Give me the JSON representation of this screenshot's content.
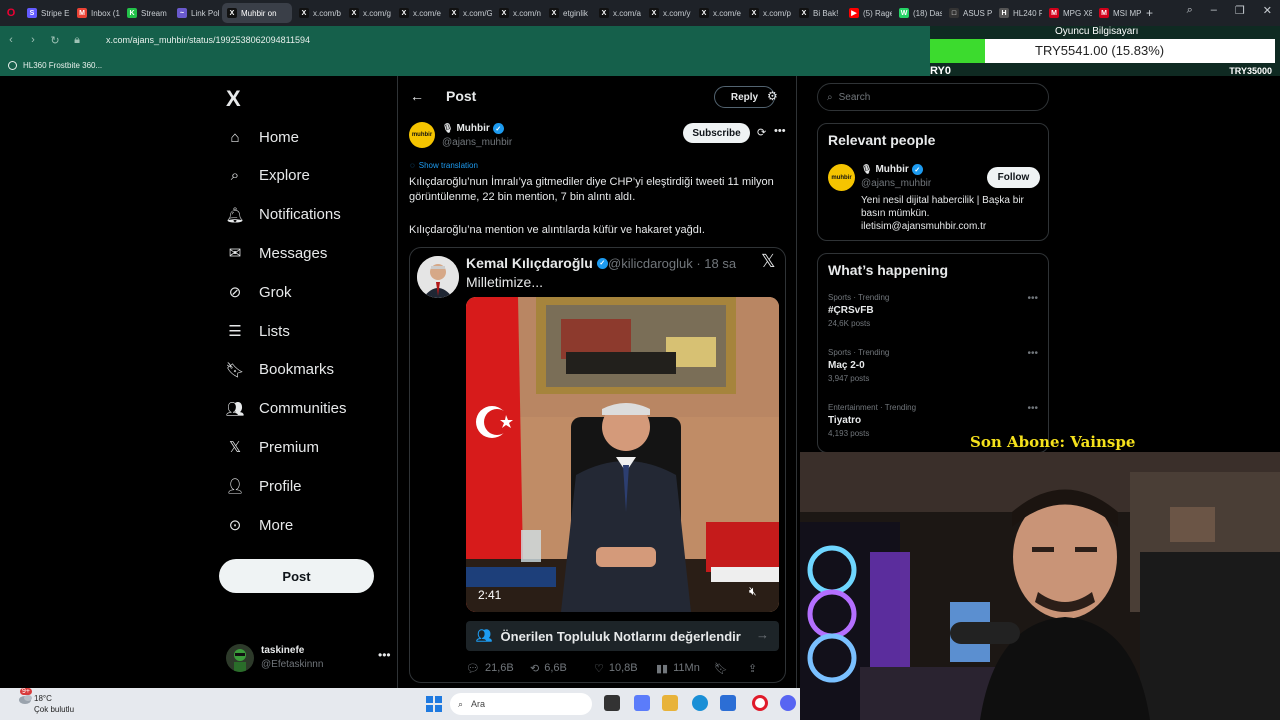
{
  "browser": {
    "tabs": [
      {
        "label": "Stripe E",
        "color": "#635bff",
        "icon": "S"
      },
      {
        "label": "Inbox (1",
        "color": "#ea4335",
        "icon": "M"
      },
      {
        "label": "Stream",
        "color": "#23c24a",
        "icon": "K"
      },
      {
        "label": "Link Pol",
        "color": "#6a5acd",
        "icon": "~"
      },
      {
        "label": "Muhbir on",
        "color": "#111111",
        "icon": "X",
        "active": true
      },
      {
        "label": "x.com/b",
        "color": "#111111",
        "icon": "X"
      },
      {
        "label": "x.com/g",
        "color": "#111111",
        "icon": "X"
      },
      {
        "label": "x.com/e",
        "color": "#111111",
        "icon": "X"
      },
      {
        "label": "x.com/G",
        "color": "#111111",
        "icon": "X"
      },
      {
        "label": "x.com/n",
        "color": "#111111",
        "icon": "X"
      },
      {
        "label": "etginlik",
        "color": "#111111",
        "icon": "X"
      },
      {
        "label": "x.com/a",
        "color": "#111111",
        "icon": "X"
      },
      {
        "label": "x.com/y",
        "color": "#111111",
        "icon": "X"
      },
      {
        "label": "x.com/e",
        "color": "#111111",
        "icon": "X"
      },
      {
        "label": "x.com/p",
        "color": "#111111",
        "icon": "X"
      },
      {
        "label": "Bi Bak!",
        "color": "#111111",
        "icon": "X"
      },
      {
        "label": "(5) Rage",
        "color": "#ff0000",
        "icon": "▶"
      },
      {
        "label": "(18) Das",
        "color": "#25d366",
        "icon": "W"
      },
      {
        "label": "ASUS P",
        "color": "#333333",
        "icon": "□"
      },
      {
        "label": "HL240 F",
        "color": "#555555",
        "icon": "H"
      },
      {
        "label": "MPG X8",
        "color": "#d0021b",
        "icon": "M"
      },
      {
        "label": "MSI MP",
        "color": "#d0021b",
        "icon": "M"
      }
    ],
    "url": "x.com/ajans_muhbir/status/1992538062094811594",
    "bookmark": "HL360 Frostbite 360..."
  },
  "overlay": {
    "title": "Oyuncu Bilgisayarı",
    "amount_text": "TRY5541.00 (15.83%)",
    "progress": 0.1583,
    "left_label": "RY0",
    "right_label": "TRY35000",
    "fill_color": "#3cdb2e",
    "last_sub": "Son Abone: Vainspe"
  },
  "sidebar": {
    "logo": "X",
    "items": [
      {
        "label": "Home",
        "icon": "home-icon"
      },
      {
        "label": "Explore",
        "icon": "search-icon"
      },
      {
        "label": "Notifications",
        "icon": "bell-icon"
      },
      {
        "label": "Messages",
        "icon": "mail-icon"
      },
      {
        "label": "Grok",
        "icon": "grok-icon"
      },
      {
        "label": "Lists",
        "icon": "list-icon"
      },
      {
        "label": "Bookmarks",
        "icon": "bookmark-icon"
      },
      {
        "label": "Communities",
        "icon": "people-icon"
      },
      {
        "label": "Premium",
        "icon": "x-icon"
      },
      {
        "label": "Profile",
        "icon": "person-icon"
      },
      {
        "label": "More",
        "icon": "more-circle-icon"
      }
    ],
    "post_button": "Post",
    "account": {
      "name": "taskinefe",
      "handle": "@Efetaskinnn"
    }
  },
  "post": {
    "header_title": "Post",
    "reply_label": "Reply",
    "author": {
      "name": "Muhbir",
      "handle": "@ajans_muhbir",
      "avatar_text": "muhbir"
    },
    "subscribe_label": "Subscribe",
    "show_translation": "Show translation",
    "text1": "Kılıçdaroğlu’nun İmralı’ya gitmediler diye CHP’yi eleştirdiği tweeti 11 milyon görüntülenme, 22 bin mention, 7 bin alıntı aldı.",
    "text2": "Kılıçdaroğlu’na mention ve alıntılarda küfür ve hakaret yağdı.",
    "quote": {
      "name": "Kemal Kılıçdaroğlu",
      "handle": "@kilicdarogluk · 18 sa",
      "text": "Milletimize...",
      "duration": "2:41"
    },
    "notes_label": "Önerilen Topluluk Notlarını değerlendir",
    "stats": {
      "replies": "21,6B",
      "reposts": "6,6B",
      "likes": "10,8B",
      "views": "11Mn"
    }
  },
  "right": {
    "search_placeholder": "Search",
    "relevant_title": "Relevant people",
    "relevant": {
      "name": "Muhbir",
      "handle": "@ajans_muhbir",
      "avatar_text": "muhbir",
      "follow_label": "Follow",
      "bio": "Yeni nesil dijital habercilik | Başka bir basın mümkün. iletisim@ajansmuhbir.com.tr"
    },
    "happening_title": "What’s happening",
    "trends": [
      {
        "meta": "Sports · Trending",
        "name": "#ÇRSvFB",
        "posts": "24,6K posts"
      },
      {
        "meta": "Sports · Trending",
        "name": "Maç 2-0",
        "posts": "3,947 posts"
      },
      {
        "meta": "Entertainment · Trending",
        "name": "Tiyatro",
        "posts": "4,193 posts"
      }
    ]
  },
  "taskbar": {
    "temp": "18°C",
    "weather": "Çok bulutlu",
    "search_placeholder": "Ara",
    "badge": "9+"
  }
}
